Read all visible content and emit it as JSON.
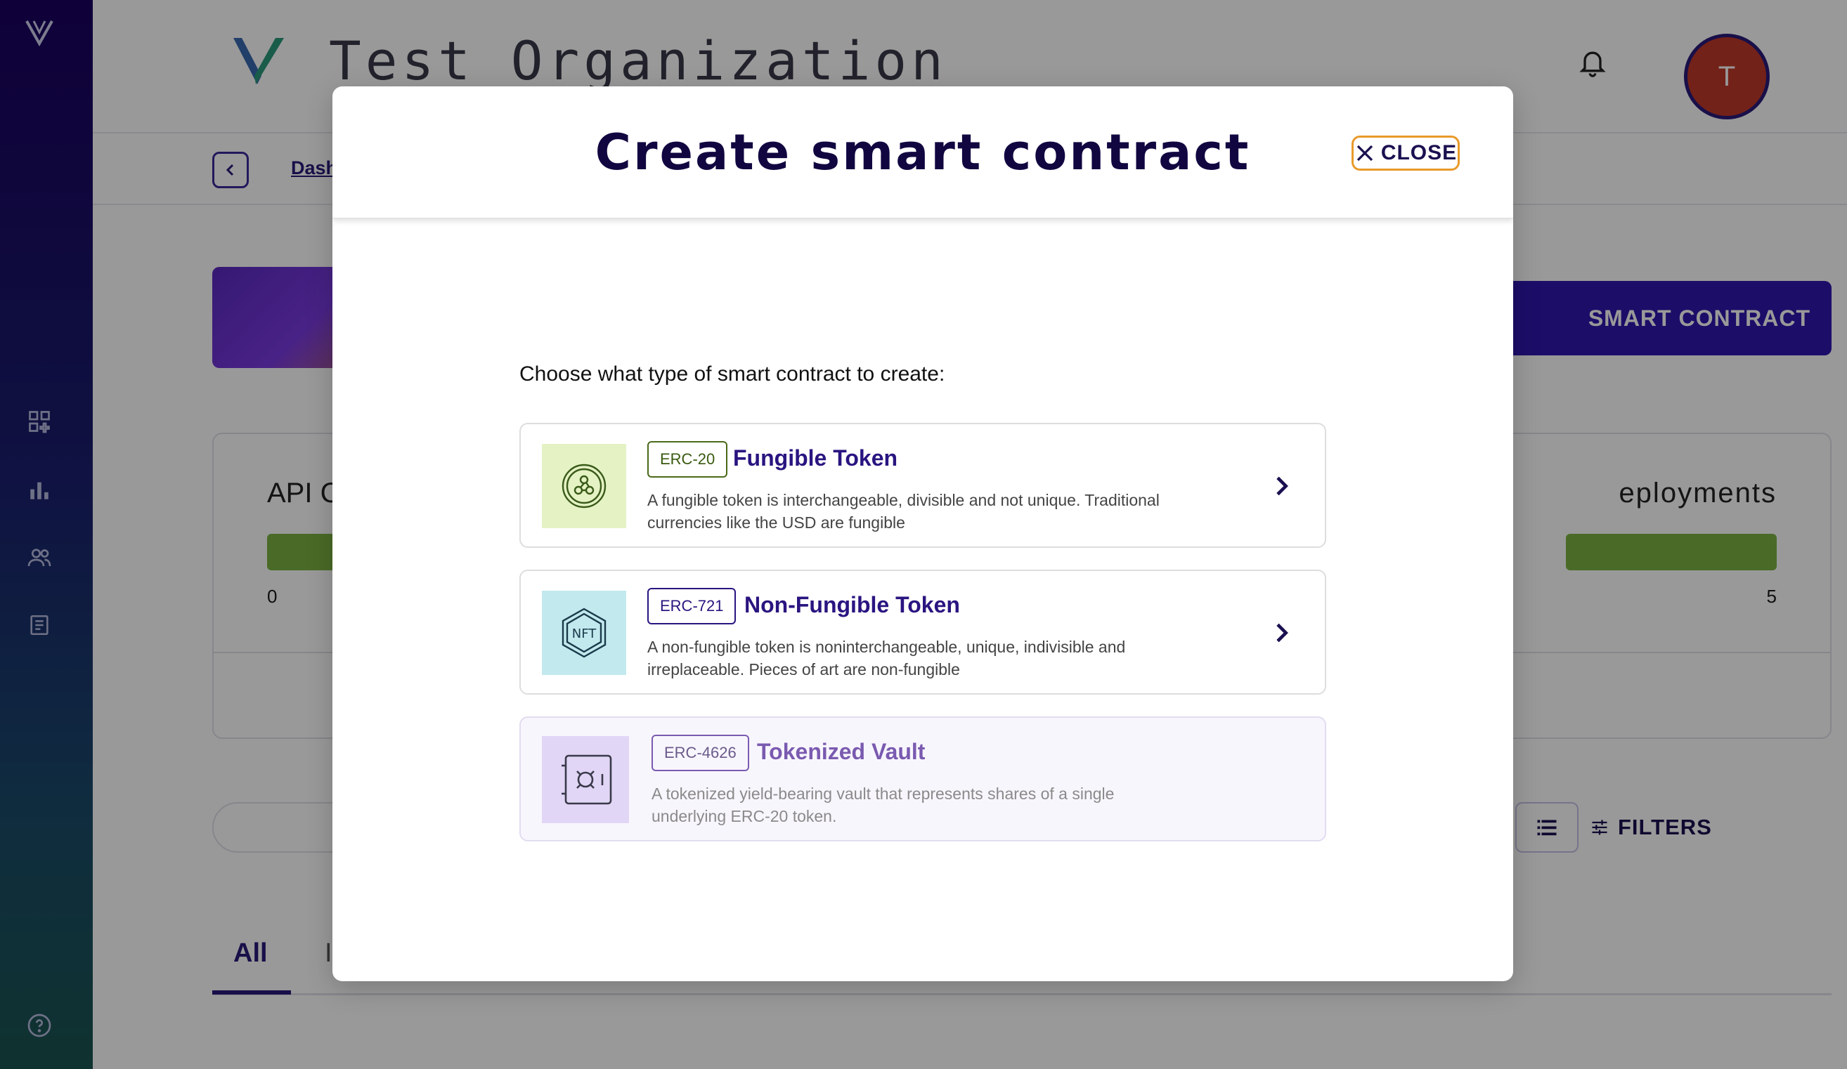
{
  "header": {
    "org_title": "Test Organization",
    "avatar_initial": "T"
  },
  "subnav": {
    "breadcrumb": "Dash"
  },
  "cta": {
    "label": "SMART CONTRACT"
  },
  "stats": {
    "left_label": "API C",
    "left_min": "0",
    "right_label": "eployments",
    "right_max": "5"
  },
  "toolbar": {
    "filters_label": "FILTERS"
  },
  "tabs": [
    {
      "label": "All"
    },
    {
      "label": "I"
    }
  ],
  "modal": {
    "title": "Create smart contract",
    "close_label": "CLOSE",
    "prompt": "Choose what type of smart contract to create:",
    "options": [
      {
        "badge": "ERC-20",
        "title": "Fungible Token",
        "description": "A fungible token is interchangeable, divisible and not unique. Traditional currencies like the USD are fungible",
        "icon": "fungible-token-icon",
        "disabled": false
      },
      {
        "badge": "ERC-721",
        "title": "Non-Fungible Token",
        "description": "A non-fungible token is noninterchangeable, unique, indivisible and irreplaceable. Pieces of art are non-fungible",
        "icon": "nft-icon",
        "icon_text": "NFT",
        "disabled": false
      },
      {
        "badge": "ERC-4626",
        "title": "Tokenized Vault",
        "description": "A tokenized yield-bearing vault that represents shares of a single underlying ERC-20 token.",
        "icon": "vault-icon",
        "disabled": true
      }
    ]
  },
  "colors": {
    "primary": "#2f17b0",
    "title": "#110640",
    "accent_orange": "#e89a2a",
    "erc20_bg": "#e4f2c4",
    "erc721_bg": "#c2e9ee",
    "erc4626_bg": "#e2d6f6"
  }
}
